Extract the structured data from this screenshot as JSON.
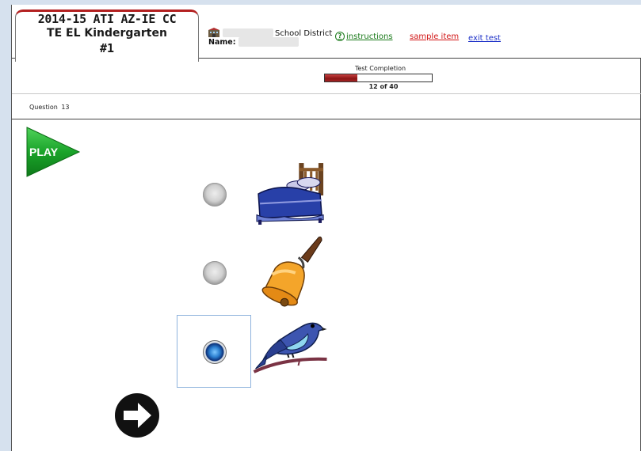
{
  "header": {
    "title_line1": "2014-15 ATI AZ-IE CC",
    "title_line2": "TE EL Kindergarten",
    "title_line3": "#1",
    "district_label": "School District",
    "name_label": "Name:",
    "instructions_label": "instructions",
    "sample_item_label": "sample item",
    "exit_test_label": "exit test"
  },
  "progress": {
    "title": "Test Completion",
    "current": 12,
    "total": 40,
    "count_text": "12 of 40",
    "fill_color": "#a52525"
  },
  "question": {
    "label": "Question 13"
  },
  "controls": {
    "play_label": "PLAY"
  },
  "choices": [
    {
      "picture": "bed",
      "selected": false
    },
    {
      "picture": "bell",
      "selected": false
    },
    {
      "picture": "bird",
      "selected": true
    }
  ],
  "colors": {
    "page_background": "#d6e1ee",
    "play_green": "#1aa32a",
    "selection_border": "#8fb3dd",
    "instructions_green": "#1a7a1a",
    "sample_item_red": "#d11414",
    "exit_test_blue": "#1b2fc7"
  },
  "icons": [
    "school-icon",
    "help-icon",
    "play-icon",
    "next-arrow-icon"
  ]
}
